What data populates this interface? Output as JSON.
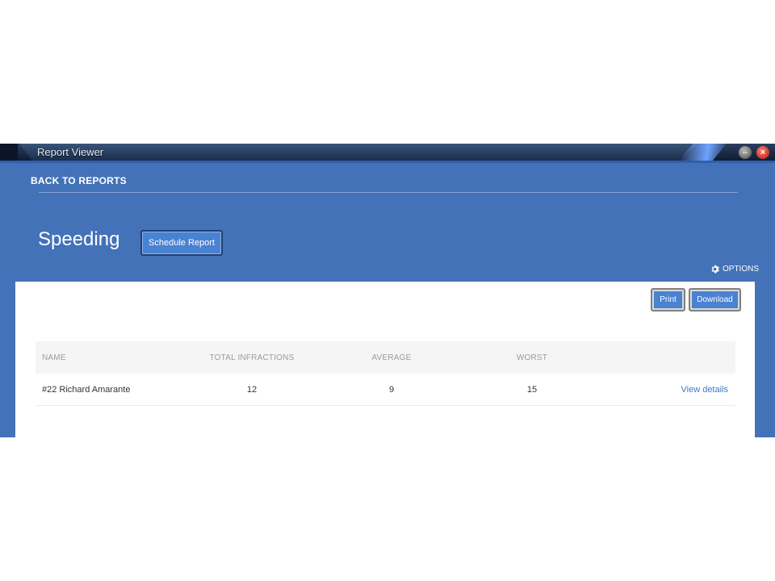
{
  "window": {
    "title": "Report Viewer",
    "minimize_glyph": "–",
    "close_glyph": "×"
  },
  "nav": {
    "back_label": "BACK TO REPORTS"
  },
  "report": {
    "title": "Speeding",
    "schedule_label": "Schedule Report",
    "options_label": "OPTIONS"
  },
  "toolbar": {
    "print_label": "Print",
    "download_label": "Download"
  },
  "table": {
    "headers": {
      "name": "NAME",
      "total": "TOTAL INFRACTIONS",
      "average": "AVERAGE",
      "worst": "WORST"
    },
    "rows": [
      {
        "name": "#22 Richard Amarante",
        "total": "12",
        "average": "9",
        "worst": "15",
        "action": "View details"
      }
    ]
  },
  "colors": {
    "app_background": "#4372b8",
    "button": "#4a82d2",
    "link": "#3e78c8"
  },
  "icons": {
    "options": "gear-icon",
    "minimize": "minimize-icon",
    "close": "close-icon"
  }
}
